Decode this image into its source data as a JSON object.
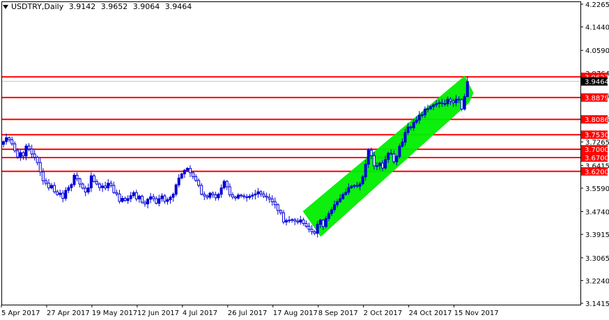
{
  "header": {
    "symbol_tf": "USDTRY,Daily",
    "open": "3.9142",
    "high": "3.9652",
    "low": "3.9064",
    "close": "3.9464"
  },
  "colors": {
    "bull": "#0000d8",
    "bear": "#0000d8",
    "level": "#ff0000",
    "channel": "#00ee00",
    "frame": "#000000"
  },
  "chart_data": {
    "type": "candlestick",
    "symbol": "USDTRY",
    "timeframe": "Daily",
    "ylim": [
      3.1415,
      4.2265
    ],
    "y_ticks": [
      4.2265,
      4.144,
      4.059,
      3.9764,
      3.8936,
      3.8086,
      3.7265,
      3.6415,
      3.559,
      3.474,
      3.3915,
      3.3065,
      3.224,
      3.1415
    ],
    "x_tick_labels": [
      "5 Apr 2017",
      "27 Apr 2017",
      "19 May 2017",
      "12 Jun 2017",
      "4 Jul 2017",
      "26 Jul 2017",
      "17 Aug 2017",
      "8 Sep 2017",
      "2 Oct 2017",
      "24 Oct 2017",
      "15 Nov 2017"
    ],
    "x_tick_index": [
      0,
      16,
      32,
      48,
      64,
      80,
      96,
      112,
      128,
      144,
      160
    ],
    "n_bars": 165,
    "current_price": "3.9464",
    "levels": [
      {
        "value": 3.9627,
        "label": "3.9627"
      },
      {
        "value": 3.8879,
        "label": "3.8879"
      },
      {
        "value": 3.8086,
        "label": "3.8086"
      },
      {
        "value": 3.753,
        "label": "3.7530"
      },
      {
        "value": 3.7,
        "label": "3.7000"
      },
      {
        "value": 3.67,
        "label": "3.6700"
      },
      {
        "value": 3.62,
        "label": "3.6200"
      }
    ],
    "channel": {
      "start_index": 106,
      "end_index": 165,
      "upper_start": 3.475,
      "upper_end": 3.965,
      "lower_start": 3.385,
      "lower_end": 3.87
    },
    "closes": [
      3.728,
      3.742,
      3.735,
      3.72,
      3.695,
      3.672,
      3.688,
      3.676,
      3.712,
      3.701,
      3.683,
      3.671,
      3.652,
      3.618,
      3.586,
      3.577,
      3.56,
      3.569,
      3.546,
      3.536,
      3.541,
      3.522,
      3.551,
      3.561,
      3.572,
      3.606,
      3.593,
      3.574,
      3.559,
      3.545,
      3.56,
      3.604,
      3.583,
      3.574,
      3.561,
      3.567,
      3.56,
      3.577,
      3.569,
      3.543,
      3.538,
      3.511,
      3.522,
      3.514,
      3.521,
      3.532,
      3.543,
      3.52,
      3.53,
      3.508,
      3.502,
      3.519,
      3.528,
      3.521,
      3.504,
      3.521,
      3.531,
      3.511,
      3.517,
      3.526,
      3.537,
      3.571,
      3.596,
      3.611,
      3.624,
      3.631,
      3.615,
      3.601,
      3.587,
      3.569,
      3.537,
      3.531,
      3.526,
      3.541,
      3.535,
      3.524,
      3.537,
      3.56,
      3.584,
      3.564,
      3.535,
      3.527,
      3.523,
      3.534,
      3.531,
      3.528,
      3.525,
      3.53,
      3.534,
      3.538,
      3.546,
      3.538,
      3.53,
      3.526,
      3.52,
      3.51,
      3.499,
      3.478,
      3.47,
      3.436,
      3.442,
      3.443,
      3.445,
      3.44,
      3.436,
      3.444,
      3.431,
      3.421,
      3.41,
      3.401,
      3.395,
      3.428,
      3.443,
      3.42,
      3.449,
      3.467,
      3.481,
      3.499,
      3.51,
      3.521,
      3.536,
      3.544,
      3.561,
      3.566,
      3.569,
      3.566,
      3.575,
      3.6,
      3.646,
      3.697,
      3.677,
      3.64,
      3.64,
      3.65,
      3.632,
      3.663,
      3.686,
      3.683,
      3.655,
      3.674,
      3.711,
      3.726,
      3.761,
      3.781,
      3.778,
      3.798,
      3.806,
      3.824,
      3.825,
      3.846,
      3.847,
      3.855,
      3.861,
      3.866,
      3.869,
      3.866,
      3.865,
      3.882,
      3.875,
      3.869,
      3.882,
      3.88,
      3.846,
      3.891,
      3.946
    ]
  }
}
